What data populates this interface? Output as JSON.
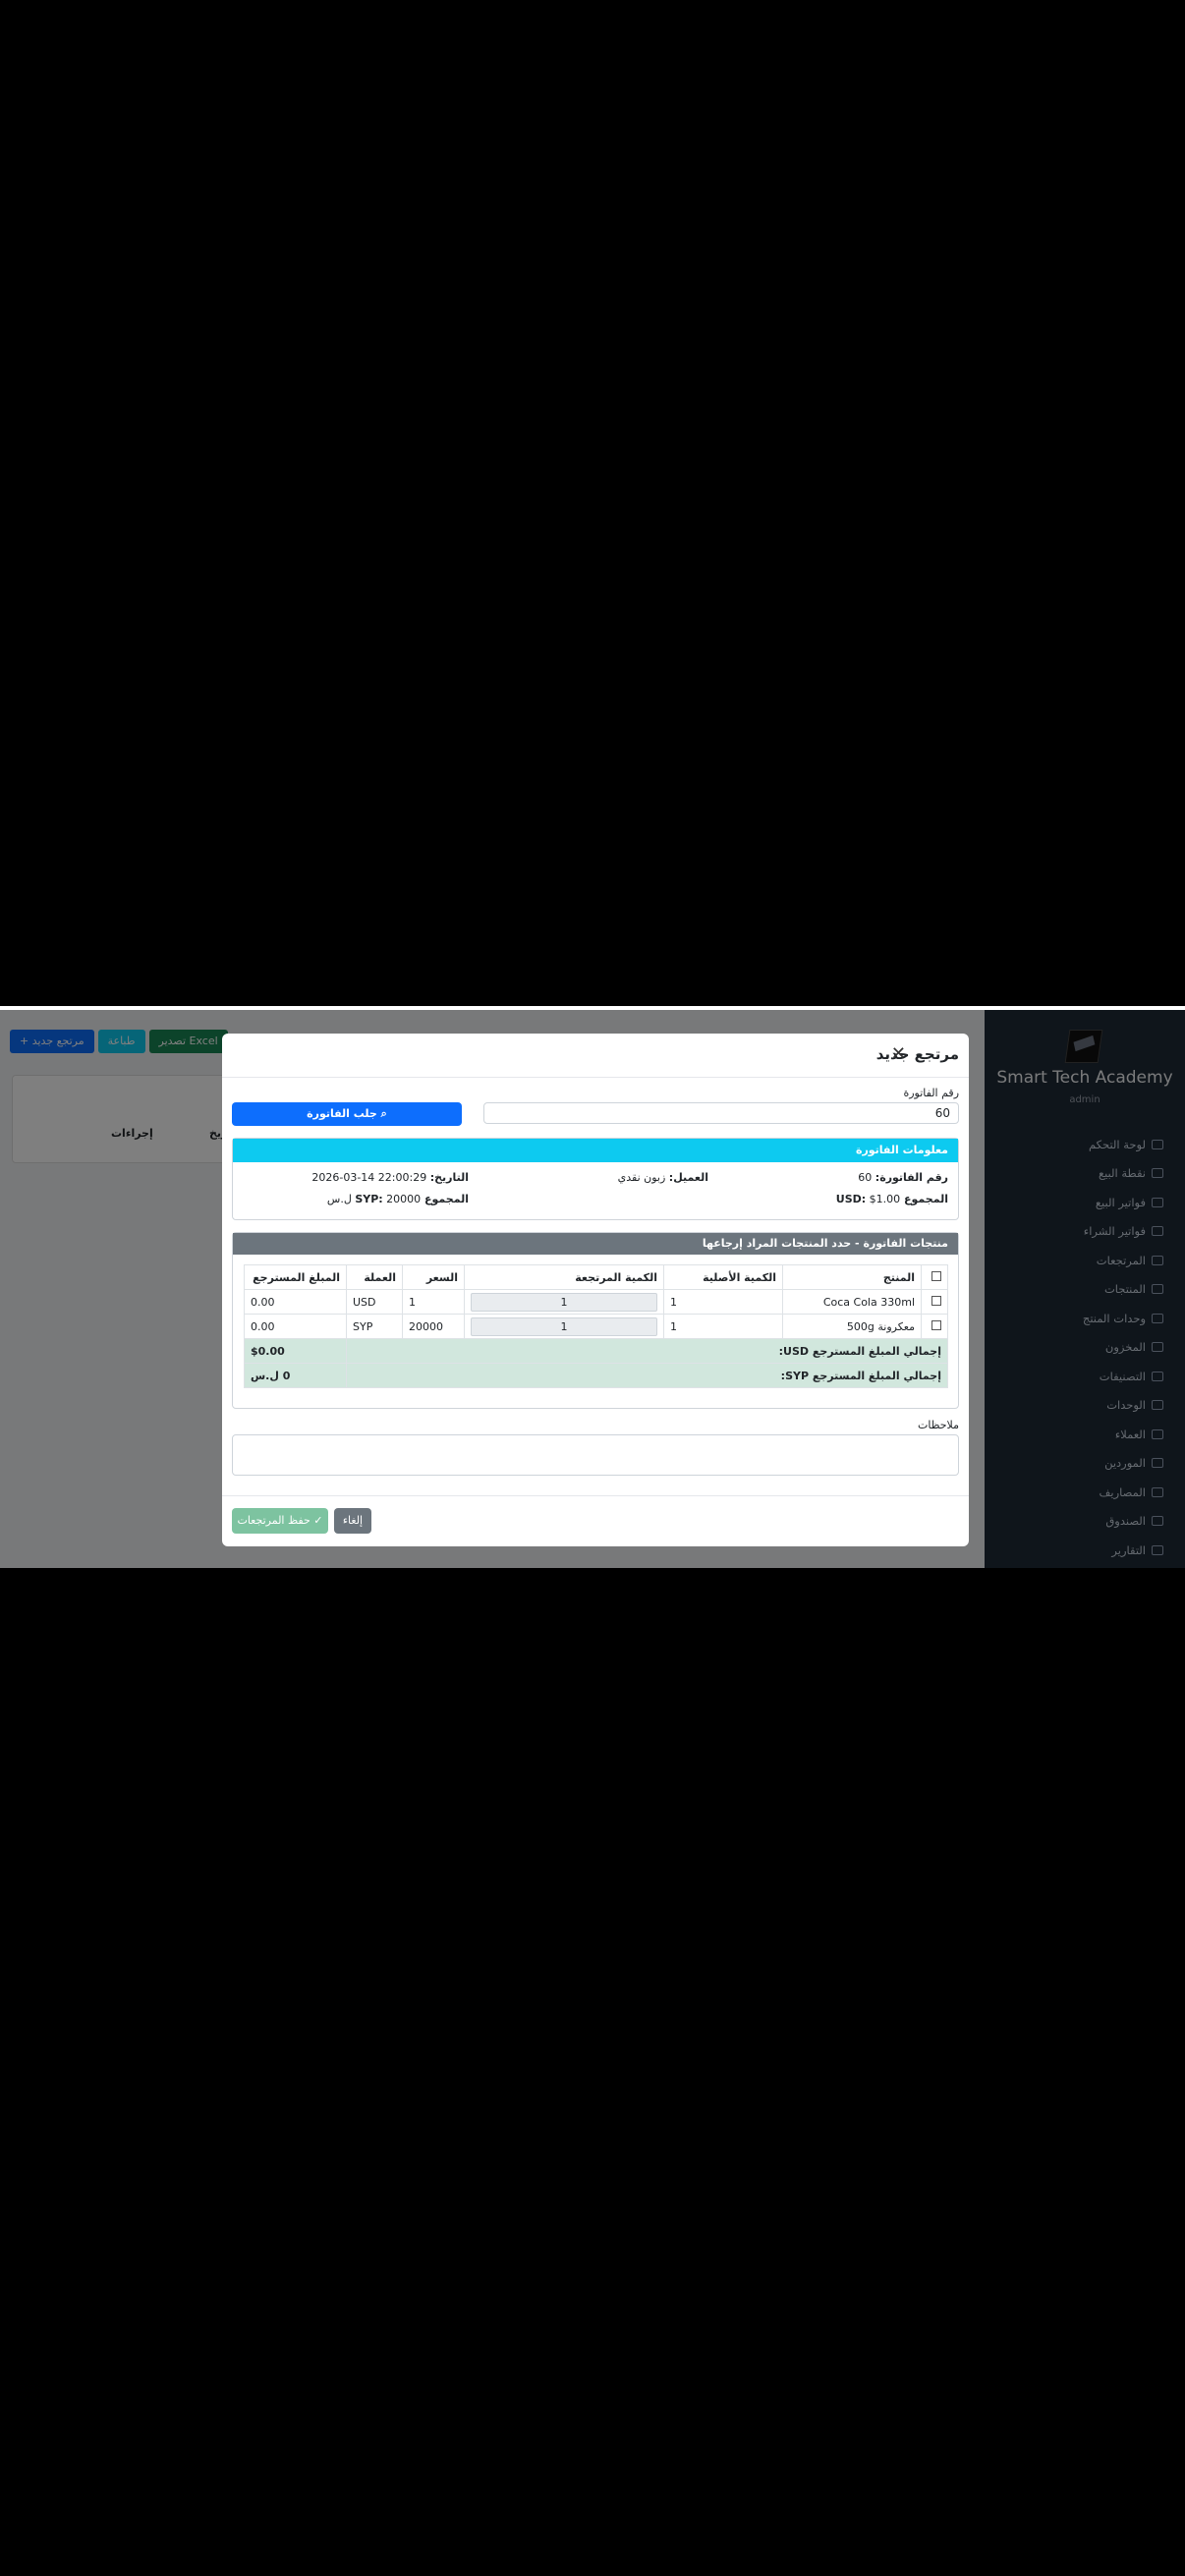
{
  "sidebar": {
    "brand": "Smart Tech Academy",
    "user": "admin",
    "items": [
      {
        "label": "لوحة التحكم",
        "icon": "dashboard-icon"
      },
      {
        "label": "نقطة البيع",
        "icon": "cart-icon"
      },
      {
        "label": "فواتير البيع",
        "icon": "invoice-icon"
      },
      {
        "label": "فواتير الشراء",
        "icon": "bag-icon"
      },
      {
        "label": "المرتجعات",
        "icon": "return-icon"
      },
      {
        "label": "المنتجات",
        "icon": "box-icon"
      },
      {
        "label": "وحدات المنتج",
        "icon": "units-icon"
      },
      {
        "label": "المخزون",
        "icon": "stock-icon"
      },
      {
        "label": "التصنيفات",
        "icon": "tag-icon"
      },
      {
        "label": "الوحدات",
        "icon": "ruler-icon"
      },
      {
        "label": "العملاء",
        "icon": "users-icon"
      },
      {
        "label": "الموردين",
        "icon": "truck-icon"
      },
      {
        "label": "المصاريف",
        "icon": "money-icon"
      },
      {
        "label": "الصندوق",
        "icon": "safe-icon"
      },
      {
        "label": "التقارير",
        "icon": "chart-icon"
      }
    ]
  },
  "page": {
    "btn_new": "+ مرتجع جديد",
    "btn_print": "طباعة",
    "btn_export": "تصدير Excel",
    "col_actions": "إجراءات",
    "col_date": "ريخ"
  },
  "modal": {
    "title": "مرتجع جديد",
    "invoice_label": "رقم الفاتورة",
    "invoice_value": "60",
    "fetch_button": "جلب الفاتورة",
    "info_title": "معلومات الفاتورة",
    "info": {
      "inv_label": "رقم الفاتورة:",
      "inv_value": "60",
      "customer_label": "العميل:",
      "customer_value": "زبون نقدي",
      "date_label": "التاريخ:",
      "date_value": "2026-03-14 22:00:29",
      "usd_total_label": "المجموع USD:",
      "usd_total_value": "$1.00",
      "syp_total_label": "المجموع SYP:",
      "syp_total_value": "20000 ل.س"
    },
    "products_title": "منتجات الفاتورة - حدد المنتجات المراد إرجاعها",
    "table": {
      "headers": [
        "",
        "المنتج",
        "الكمية الأصلية",
        "الكمية المرتجعة",
        "السعر",
        "العملة",
        "المبلغ المسترجع"
      ],
      "rows": [
        {
          "product": "Coca Cola 330ml",
          "orig_qty": "1",
          "ret_qty": "1",
          "price": "1",
          "currency": "USD",
          "amount": "0.00"
        },
        {
          "product": "معكرونة 500g",
          "orig_qty": "1",
          "ret_qty": "1",
          "price": "20000",
          "currency": "SYP",
          "amount": "0.00"
        }
      ],
      "total_usd_label": "إجمالي المبلغ المسترجع USD:",
      "total_usd_value": "$0.00",
      "total_syp_label": "إجمالي المبلغ المسترجع SYP:",
      "total_syp_value": "0 ل.س"
    },
    "notes_label": "ملاحظات",
    "save_button": "حفظ المرتجعات",
    "cancel_button": "إلغاء"
  }
}
